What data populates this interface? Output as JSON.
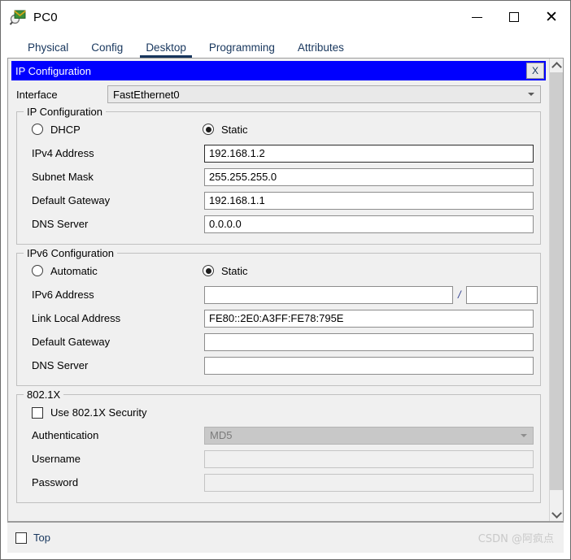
{
  "window": {
    "title": "PC0",
    "icon": "packet-tracer-pc-icon",
    "controls": {
      "minimize": "minimize-icon",
      "maximize": "maximize-icon",
      "close": "close-icon"
    }
  },
  "tabs": [
    {
      "label": "Physical",
      "active": false
    },
    {
      "label": "Config",
      "active": false
    },
    {
      "label": "Desktop",
      "active": true
    },
    {
      "label": "Programming",
      "active": false
    },
    {
      "label": "Attributes",
      "active": false
    }
  ],
  "dialog": {
    "title": "IP Configuration",
    "close_label": "X",
    "titlebar_color": "#0000ff",
    "accent_color": "#17365d"
  },
  "interface": {
    "label": "Interface",
    "value": "FastEthernet0",
    "options": [
      "FastEthernet0"
    ]
  },
  "ipv4": {
    "group_title": "IP Configuration",
    "mode": {
      "dhcp_label": "DHCP",
      "dhcp_selected": false,
      "static_label": "Static",
      "static_selected": true
    },
    "fields": [
      {
        "label": "IPv4 Address",
        "value": "192.168.1.2",
        "focused": true
      },
      {
        "label": "Subnet Mask",
        "value": "255.255.255.0",
        "focused": false
      },
      {
        "label": "Default Gateway",
        "value": "192.168.1.1",
        "focused": false
      },
      {
        "label": "DNS Server",
        "value": "0.0.0.0",
        "focused": false
      }
    ]
  },
  "ipv6": {
    "group_title": "IPv6 Configuration",
    "mode": {
      "automatic_label": "Automatic",
      "automatic_selected": false,
      "static_label": "Static",
      "static_selected": true
    },
    "address": {
      "label": "IPv6 Address",
      "value": "",
      "separator": "/",
      "prefix_length": ""
    },
    "fields": [
      {
        "label": "Link Local Address",
        "value": "FE80::2E0:A3FF:FE78:795E"
      },
      {
        "label": "Default Gateway",
        "value": ""
      },
      {
        "label": "DNS Server",
        "value": ""
      }
    ]
  },
  "dot1x": {
    "group_title": "802.1X",
    "use_security_label": "Use 802.1X Security",
    "use_security_checked": false,
    "authentication": {
      "label": "Authentication",
      "value": "MD5",
      "disabled": true
    },
    "username": {
      "label": "Username",
      "value": "",
      "disabled": true
    },
    "password": {
      "label": "Password",
      "value": "",
      "disabled": true
    }
  },
  "footer": {
    "top_label": "Top",
    "top_checked": false,
    "watermark": "CSDN @阿疯点"
  },
  "scrollbar": {
    "up_icon": "chevron-up-icon",
    "down_icon": "chevron-down-icon"
  }
}
